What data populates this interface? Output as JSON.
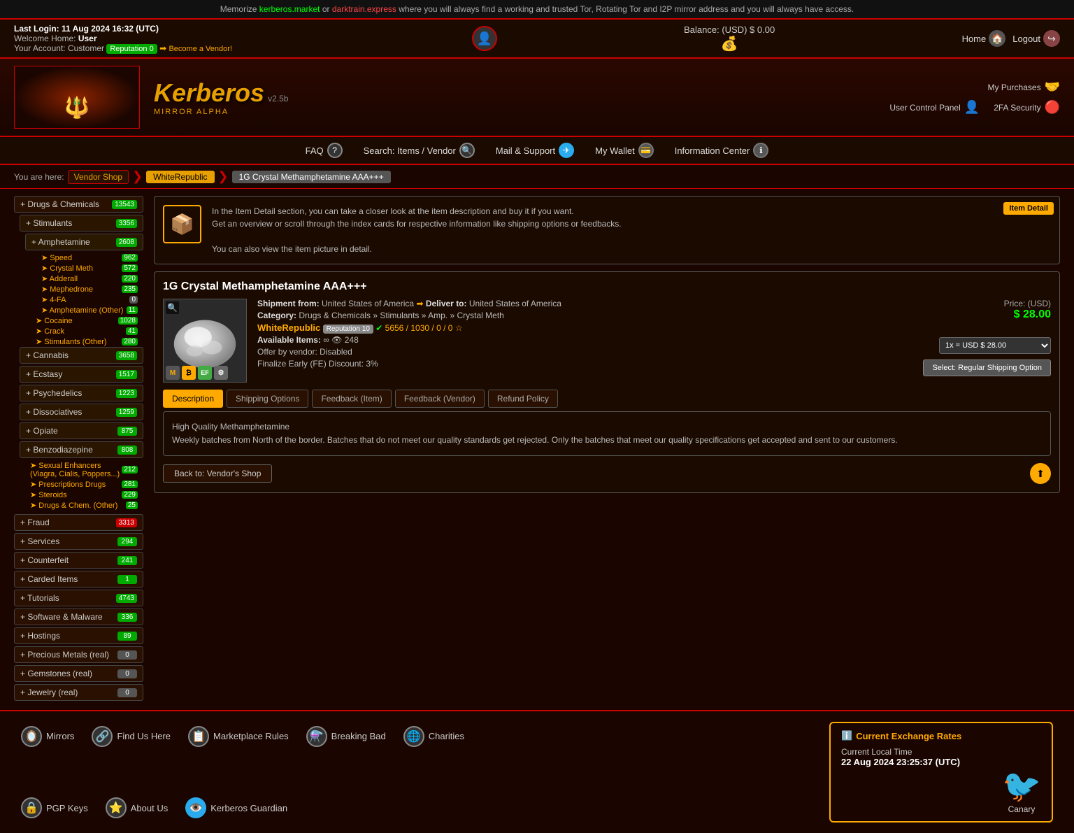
{
  "topBanner": {
    "text1": "Memorize ",
    "link1": "kerberos.market",
    "text2": " or ",
    "link2": "darktrain.express",
    "text3": " where you will always find a working and trusted Tor, Rotating Tor and I2P mirror address and you will always have access."
  },
  "header": {
    "lastLogin": "Last Login: 11 Aug 2024 16:32 (UTC)",
    "welcomeLabel": "Welcome Home:",
    "welcomeUser": "User",
    "accountLabel": "Your Account:",
    "accountType": "Customer",
    "reputationLabel": "Reputation 0",
    "becomeVendor": "Become a Vendor!",
    "balance": "Balance: (USD) $ 0.00",
    "homeLabel": "Home",
    "logoutLabel": "Logout"
  },
  "logo": {
    "title": "Kerberos",
    "version": "v2.5b",
    "mirror": "MIRROR ALPHA"
  },
  "logoRight": {
    "myPurchases": "My Purchases",
    "userControlPanel": "User Control Panel",
    "twoFASecurity": "2FA Security"
  },
  "nav": {
    "faq": "FAQ",
    "search": "Search: Items / Vendor",
    "mailSupport": "Mail & Support",
    "myWallet": "My Wallet",
    "informationCenter": "Information Center"
  },
  "breadcrumb": {
    "youAreHere": "You are here:",
    "vendorShop": "Vendor Shop",
    "vendorName": "WhiteRepublic",
    "itemName": "1G Crystal Methamphetamine AAA+++"
  },
  "itemDetail": {
    "sectionLabel": "Item Detail",
    "text1": "In the Item Detail section, you can take a closer look at the item description and buy it if you want.",
    "text2": "Get an overview or scroll through the index cards for respective information like shipping options or feedbacks.",
    "text3": "You can also view the item picture in detail."
  },
  "product": {
    "title": "1G Crystal Methamphetamine AAA+++",
    "shipFrom": "United States of America",
    "shipTo": "United States of America",
    "category": "Drugs & Chemicals",
    "subcategory1": "Stimulants",
    "subcategory2": "Amp.",
    "subcategory3": "Crystal Meth",
    "vendorName": "WhiteRepublic",
    "reputationLabel": "Reputation 10",
    "salesNum": "5656",
    "sales2": "1030",
    "sales3": "0",
    "sales4": "0",
    "availableItems": "248",
    "offerByVendor": "Offer by vendor: Disabled",
    "finalizeEarly": "Finalize Early (FE) Discount: 3%",
    "price": "Price: (USD) $ 28.00",
    "priceLabel": "Price: (USD)",
    "priceValue": "$ 28.00",
    "qtyOption": "1x = USD $ 28.00",
    "selectShipping": "Select: Regular Shipping Option"
  },
  "tabs": [
    {
      "label": "Description",
      "active": true
    },
    {
      "label": "Shipping Options",
      "active": false
    },
    {
      "label": "Feedback (Item)",
      "active": false
    },
    {
      "label": "Feedback (Vendor)",
      "active": false
    },
    {
      "label": "Refund Policy",
      "active": false
    }
  ],
  "description": {
    "line1": "High Quality Methamphetamine",
    "line2": "Weekly batches from North of the border. Batches that do not meet our quality standards get rejected. Only the batches that meet our quality specifications get accepted and sent to our customers."
  },
  "backBtn": "Back to: Vendor's Shop",
  "sidebar": {
    "categories": [
      {
        "label": "+ Drugs & Chemicals",
        "badge": "13543",
        "badgeColor": "green"
      },
      {
        "label": "+ Stimulants",
        "badge": "3356",
        "badgeColor": "green",
        "indent": 1
      },
      {
        "label": "+ Amphetamine",
        "badge": "2608",
        "badgeColor": "green",
        "indent": 2
      },
      {
        "label": "Speed",
        "badge": "962",
        "indent": 3
      },
      {
        "label": "Crystal Meth",
        "badge": "572",
        "indent": 3
      },
      {
        "label": "Adderall",
        "badge": "220",
        "indent": 3
      },
      {
        "label": "Mephedrone",
        "badge": "235",
        "indent": 3
      },
      {
        "label": "4-FA",
        "badge": "0",
        "badgeColor": "zero",
        "indent": 3
      },
      {
        "label": "Amphetamine (Other)",
        "badge": "11",
        "indent": 3
      },
      {
        "label": "Cocaine",
        "badge": "1028",
        "indent": 2
      },
      {
        "label": "Crack",
        "badge": "41",
        "indent": 2
      },
      {
        "label": "Stimulants (Other)",
        "badge": "280",
        "indent": 2
      },
      {
        "label": "+ Cannabis",
        "badge": "3658",
        "badgeColor": "green",
        "indent": 1
      },
      {
        "label": "+ Ecstasy",
        "badge": "1517",
        "badgeColor": "green",
        "indent": 1
      },
      {
        "label": "+ Psychedelics",
        "badge": "1223",
        "badgeColor": "green",
        "indent": 1
      },
      {
        "label": "+ Dissociatives",
        "badge": "1259",
        "badgeColor": "green",
        "indent": 1
      },
      {
        "label": "+ Opiate",
        "badge": "875",
        "badgeColor": "green",
        "indent": 1
      },
      {
        "label": "+ Benzodiazepine",
        "badge": "808",
        "badgeColor": "green",
        "indent": 1
      },
      {
        "label": "Sexual Enhancers (Viagra, Cialis, Poppers...)",
        "badge": "212",
        "indent": 1
      },
      {
        "label": "Prescriptions Drugs",
        "badge": "281",
        "indent": 1
      },
      {
        "label": "Steroids",
        "badge": "229",
        "indent": 1
      },
      {
        "label": "Drugs & Chem. (Other)",
        "badge": "25",
        "indent": 1
      }
    ],
    "otherCategories": [
      {
        "label": "+ Fraud",
        "badge": "3313",
        "badgeColor": "red"
      },
      {
        "label": "+ Services",
        "badge": "294",
        "badgeColor": "green"
      },
      {
        "label": "+ Counterfeit",
        "badge": "241",
        "badgeColor": "green"
      },
      {
        "label": "+ Carded Items",
        "badge": "1",
        "badgeColor": "green"
      },
      {
        "label": "+ Tutorials",
        "badge": "4743",
        "badgeColor": "green"
      },
      {
        "label": "+ Software & Malware",
        "badge": "336",
        "badgeColor": "green"
      },
      {
        "label": "+ Hostings",
        "badge": "89",
        "badgeColor": "green"
      },
      {
        "label": "+ Precious Metals (real)",
        "badge": "0",
        "badgeColor": "zero"
      },
      {
        "label": "+ Gemstones (real)",
        "badge": "0",
        "badgeColor": "zero"
      },
      {
        "label": "+ Jewelry (real)",
        "badge": "0",
        "badgeColor": "zero"
      }
    ]
  },
  "footer": {
    "links": [
      {
        "label": "Mirrors",
        "icon": "🪞"
      },
      {
        "label": "Find Us Here",
        "icon": "🔗"
      },
      {
        "label": "Marketplace Rules",
        "icon": "📋"
      },
      {
        "label": "Breaking Bad",
        "icon": "⚗️"
      },
      {
        "label": "Charities",
        "icon": "🌐"
      },
      {
        "label": "PGP Keys",
        "icon": "🔒"
      },
      {
        "label": "About Us",
        "icon": "⭐"
      },
      {
        "label": "Kerberos Guardian",
        "icon": "👁️"
      }
    ],
    "exchangeTitle": "Current Exchange Rates",
    "currentLocalTime": "Current Local Time",
    "currentDateTime": "22 Aug 2024 23:25:37 (UTC)",
    "canaryLabel": "Canary"
  }
}
